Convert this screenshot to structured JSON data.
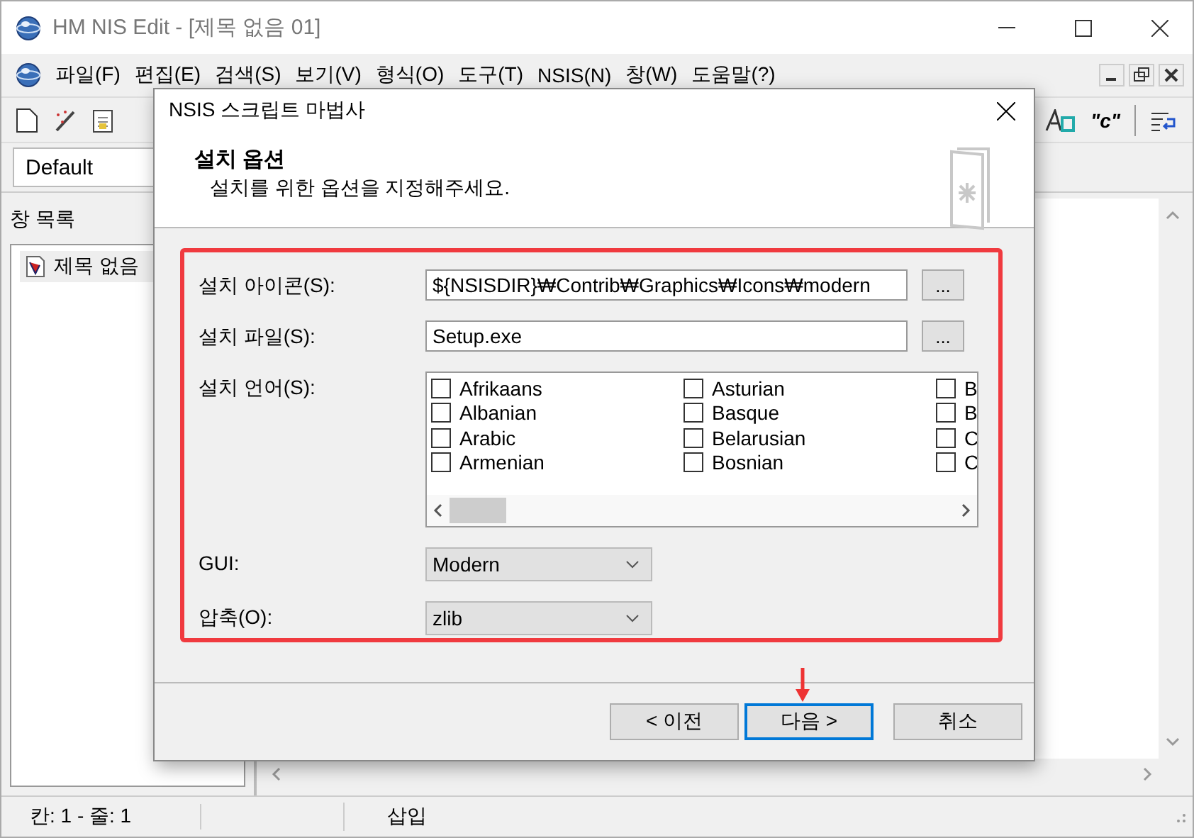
{
  "window": {
    "title": "HM NIS Edit - [제목 없음 01]"
  },
  "menu": [
    "파일(F)",
    "편집(E)",
    "검색(S)",
    "보기(V)",
    "형식(O)",
    "도구(T)",
    "NSIS(N)",
    "창(W)",
    "도움말(?)"
  ],
  "toolbar": {
    "quote_button": "\"c\""
  },
  "style_combo": {
    "value": "Default"
  },
  "window_list": {
    "title": "창 목록",
    "items": [
      {
        "label": "제목 없음",
        "selected": true
      }
    ]
  },
  "status_bar": {
    "position": "칸: 1 - 줄: 1",
    "mode": "삽입"
  },
  "dialog": {
    "title": "NSIS 스크립트 마법사",
    "heading": "설치 옵션",
    "subheading": "설치를 위한 옵션을 지정해주세요.",
    "fields": [
      {
        "kind": "text",
        "label": "설치 아이콘(S):",
        "value": "${NSISDIR}₩Contrib₩Graphics₩Icons₩modern",
        "browse": "..."
      },
      {
        "kind": "text",
        "label": "설치 파일(S):",
        "value": "Setup.exe",
        "browse": "..."
      },
      {
        "kind": "checklist",
        "label": "설치 언어(S):",
        "columns": [
          [
            {
              "label": "Afrikaans",
              "checked": false
            },
            {
              "label": "Albanian",
              "checked": false
            },
            {
              "label": "Arabic",
              "checked": false
            },
            {
              "label": "Armenian",
              "checked": false
            }
          ],
          [
            {
              "label": "Asturian",
              "checked": false
            },
            {
              "label": "Basque",
              "checked": false
            },
            {
              "label": "Belarusian",
              "checked": false
            },
            {
              "label": "Bosnian",
              "checked": false
            }
          ],
          [
            {
              "label": "B",
              "checked": false
            },
            {
              "label": "B",
              "checked": false
            },
            {
              "label": "C",
              "checked": false
            },
            {
              "label": "C",
              "checked": false
            }
          ]
        ]
      },
      {
        "kind": "select",
        "label": "GUI:",
        "value": "Modern"
      },
      {
        "kind": "select",
        "label": "압축(O):",
        "value": "zlib"
      }
    ],
    "buttons": [
      {
        "label": "< 이전",
        "focused": false
      },
      {
        "label": "다음 >",
        "focused": true
      },
      {
        "label": "취소",
        "focused": false
      }
    ]
  }
}
